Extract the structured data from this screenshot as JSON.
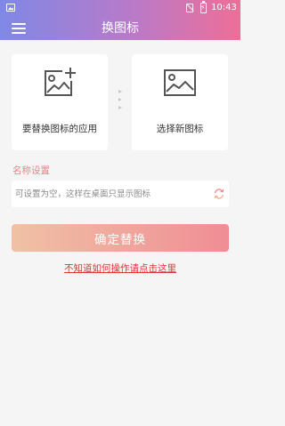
{
  "status_bar": {
    "time": "10:43",
    "icons": [
      "image-icon",
      "no-sim-icon",
      "battery-charging-icon"
    ]
  },
  "app_bar": {
    "title": "换图标",
    "menu_icon": "menu-icon"
  },
  "cards": {
    "source_app": {
      "label": "要替换图标的应用",
      "icon": "add-image-icon"
    },
    "new_icon": {
      "label": "选择新图标",
      "icon": "image-icon"
    }
  },
  "name_section": {
    "label": "名称设置",
    "placeholder": "可设置为空，这样在桌面只显示图标",
    "value": "",
    "refresh_icon": "refresh-icon"
  },
  "confirm_button": {
    "label": "确定替换"
  },
  "help_link": {
    "label": "不知道如何操作请点击这里"
  },
  "colors": {
    "header_gradient_start": "#7f88e6",
    "header_gradient_end": "#ee6e97",
    "button_gradient_start": "#f0c1a5",
    "button_gradient_end": "#f08d95",
    "section_label": "#ee7f8a",
    "link": "#e0353a",
    "background": "#f5f5f5"
  }
}
